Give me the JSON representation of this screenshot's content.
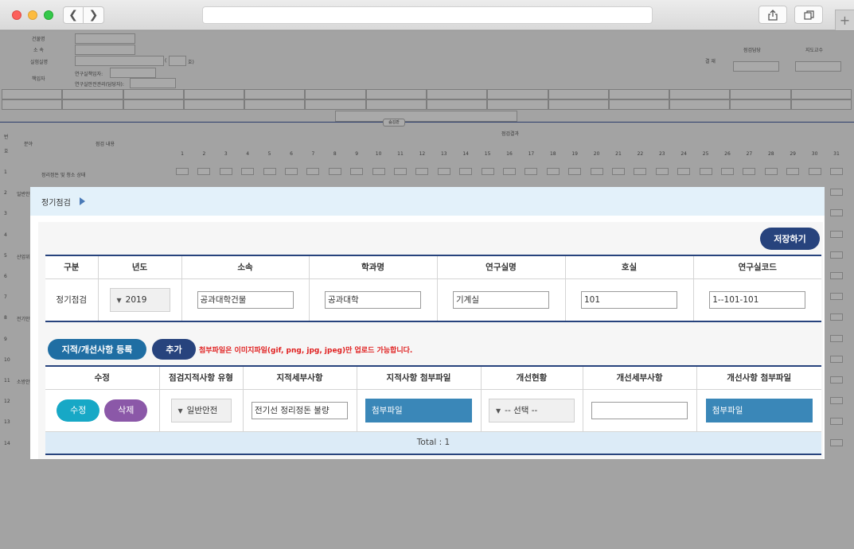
{
  "form": {
    "labels": {
      "building": "건물명",
      "affiliation": "소 속",
      "lab": "실험실명",
      "responsible": "책임자",
      "lab_manager": "연구실책임자:",
      "safety_manager": "연구실안전관리(담당자):",
      "room_suffix": "호)",
      "room_prefix": "(",
      "approval": "결 재",
      "inspector": "점검담당",
      "professor": "지도교수",
      "collapse": "숨김판",
      "col_no": "번",
      "col_no2": "호",
      "col_field": "분야",
      "col_content": "점검 내용",
      "col_result": "점검결과"
    },
    "days": [
      "1",
      "2",
      "3",
      "4",
      "5",
      "6",
      "7",
      "8",
      "9",
      "10",
      "11",
      "12",
      "13",
      "14",
      "15",
      "16",
      "17",
      "18",
      "19",
      "20",
      "21",
      "22",
      "23",
      "24",
      "25",
      "26",
      "27",
      "28",
      "29",
      "30",
      "31"
    ],
    "rows": [
      "1",
      "2",
      "3",
      "4",
      "5",
      "6",
      "7",
      "8",
      "9",
      "10",
      "11",
      "12",
      "13",
      "14"
    ],
    "row1_text": "정리정돈 및 청소 상태",
    "row2_text": "일반안",
    "row5_text": "산업위",
    "row8_text": "전기안",
    "row11_text": "소방안"
  },
  "modal": {
    "title": "정기점검",
    "save_label": "저장하기",
    "table1": {
      "headers": [
        "구분",
        "년도",
        "소속",
        "학과명",
        "연구실명",
        "호실",
        "연구실코드"
      ],
      "row": {
        "category": "정기점검",
        "year": "2019",
        "affiliation": "공과대학건물",
        "department": "공과대학",
        "lab": "기계실",
        "room": "101",
        "code": "1--101-101"
      }
    },
    "register_label": "지적/개선사항 등록",
    "add_label": "추가",
    "warning": "첨부파일은 이미지파일(gif, png, jpg, jpeg)만 업로드 가능합니다.",
    "table2": {
      "headers": [
        "수정",
        "점검지적사항 유형",
        "지적세부사항",
        "지적사항 첨부파일",
        "개선현황",
        "개선세부사항",
        "개선사항 첨부파일"
      ],
      "row": {
        "edit": "수정",
        "delete": "삭제",
        "type": "일반안전",
        "detail": "전기선 정리정돈 불량",
        "file1": "첨부파일",
        "status": "-- 선택 --",
        "improve_detail": "",
        "file2": "첨부파일"
      },
      "total": "Total : 1"
    }
  }
}
